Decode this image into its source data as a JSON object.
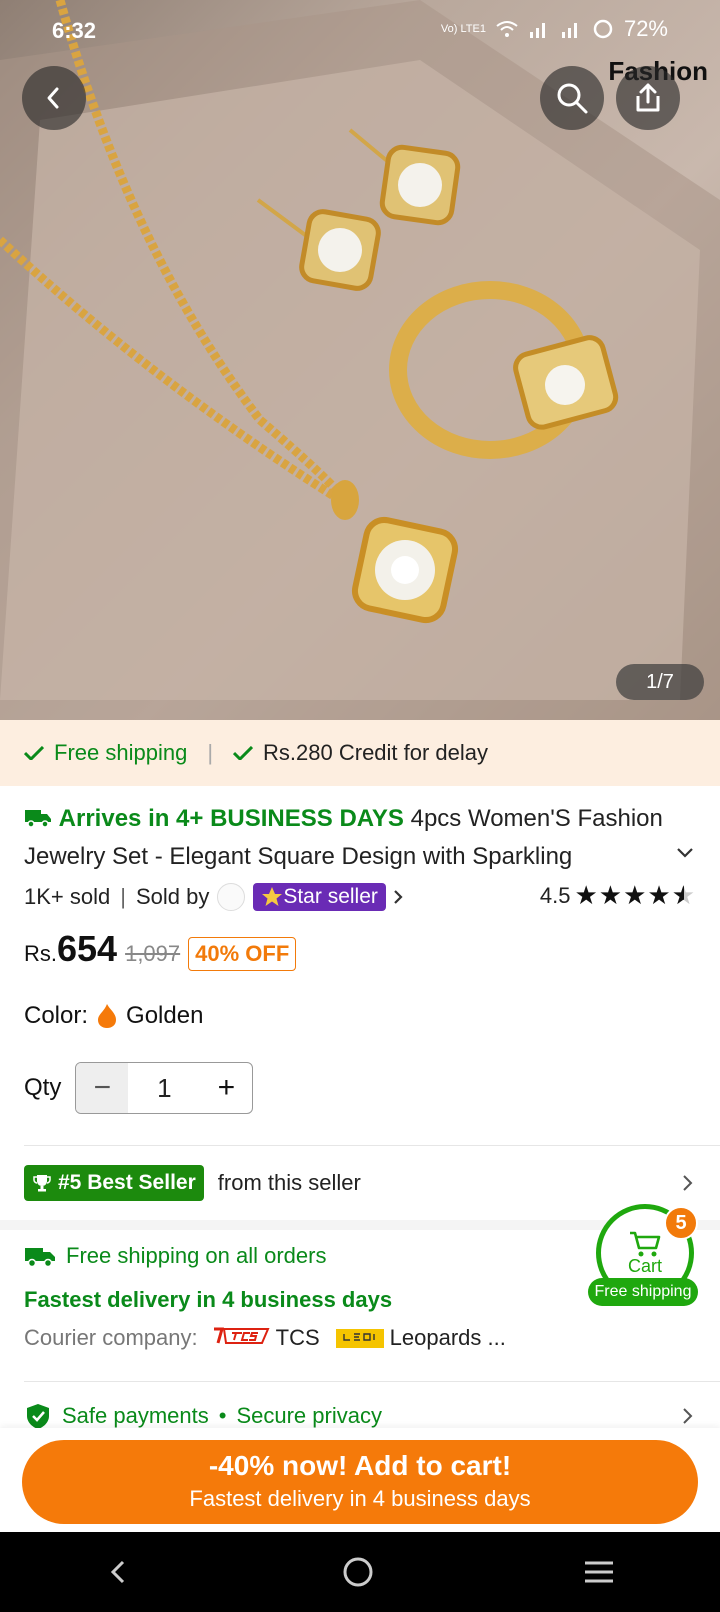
{
  "status_bar": {
    "time": "6:32",
    "network": "Vo) LTE1",
    "battery": "72%"
  },
  "hero": {
    "brand_tag": "Fashion",
    "page_indicator": "1/7"
  },
  "shipping_strip": {
    "free_shipping": "Free shipping",
    "credit": "Rs.280 Credit for delay"
  },
  "product": {
    "arrives": "Arrives in 4+ BUSINESS DAYS",
    "title": "4pcs Women'S Fashion Jewelry Set - Elegant Square Design with Sparkling",
    "sold": "1K+ sold",
    "sold_by": "Sold by",
    "star_seller": "Star seller",
    "rating": "4.5",
    "rating_value": 4.5
  },
  "price": {
    "currency": "Rs.",
    "current": "654",
    "original": "1,097",
    "discount": "40% OFF"
  },
  "color": {
    "label": "Color:",
    "value": "Golden"
  },
  "quantity": {
    "label": "Qty",
    "value": "1"
  },
  "best_seller": {
    "badge": "#5 Best Seller",
    "text": "from this seller"
  },
  "shipping_info": {
    "line1": "Free shipping on all orders",
    "line2": "Fastest delivery in 4 business days",
    "courier_label": "Courier company:",
    "courier1": "TCS",
    "courier2": "Leopards ..."
  },
  "cart": {
    "label": "Cart",
    "count": "5",
    "free_shipping": "Free shipping"
  },
  "safe": {
    "payments": "Safe payments",
    "privacy": "Secure privacy"
  },
  "cta": {
    "main": "-40% now! Add to cart!",
    "sub": "Fastest delivery in 4 business days"
  },
  "colors": {
    "accent_orange": "#f57a0a",
    "accent_green": "#0a8a1a",
    "star_seller_purple": "#6a2bb5"
  },
  "icons": [
    "back-icon",
    "search-icon",
    "share-icon",
    "check-icon",
    "truck-icon",
    "trophy-icon",
    "shield-check-icon",
    "cart-icon",
    "flame-icon",
    "chevron-right-icon",
    "chevron-down-icon"
  ]
}
